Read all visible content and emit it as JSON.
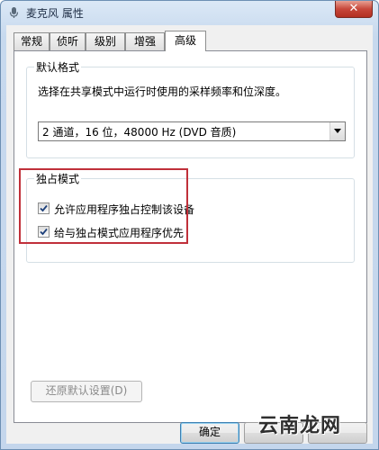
{
  "window": {
    "title": "麦克风 属性",
    "close_label": "✕"
  },
  "tabs": [
    {
      "label": "常规",
      "active": false
    },
    {
      "label": "侦听",
      "active": false
    },
    {
      "label": "级别",
      "active": false
    },
    {
      "label": "增强",
      "active": false
    },
    {
      "label": "高级",
      "active": true
    }
  ],
  "default_format": {
    "title": "默认格式",
    "description": "选择在共享模式中运行时使用的采样频率和位深度。",
    "selected": "2 通道，16 位，48000 Hz (DVD 音质)"
  },
  "exclusive": {
    "title": "独占模式",
    "items": [
      {
        "label": "允许应用程序独占控制该设备",
        "checked": true
      },
      {
        "label": "给与独占模式应用程序优先",
        "checked": true
      }
    ]
  },
  "restore_button": "还原默认设置(D)",
  "buttons": {
    "ok": "确定"
  },
  "watermark": "云南龙网",
  "colors": {
    "highlight": "#c0303a",
    "titlebar": "#c7d9ee",
    "close": "#c7473a"
  }
}
